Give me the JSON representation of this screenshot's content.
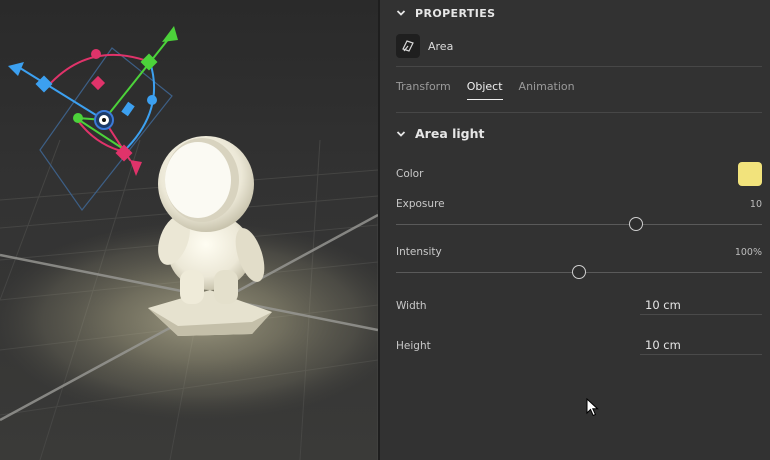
{
  "panel": {
    "section_title": "PROPERTIES",
    "object_name": "Area",
    "tabs": [
      {
        "label": "Transform",
        "active": false
      },
      {
        "label": "Object",
        "active": true
      },
      {
        "label": "Animation",
        "active": false
      }
    ],
    "group_title": "Area light",
    "color": {
      "label": "Color",
      "value": "#f2e37c"
    },
    "exposure": {
      "label": "Exposure",
      "value": "10",
      "fraction": 0.656
    },
    "intensity": {
      "label": "Intensity",
      "value": "100%",
      "fraction": 0.5
    },
    "width": {
      "label": "Width",
      "value": "10 cm"
    },
    "height": {
      "label": "Height",
      "value": "10 cm"
    }
  },
  "icons": [
    "chevron-down-icon",
    "area-light-icon",
    "cursor-icon"
  ],
  "colors": {
    "accent_light": "#f2e37c",
    "gizmo_red": "#e0336a",
    "gizmo_green": "#4cd23a",
    "gizmo_blue": "#3ca0f0"
  }
}
